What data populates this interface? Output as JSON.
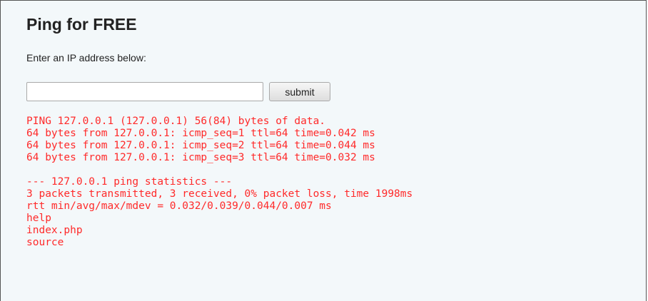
{
  "page": {
    "title": "Ping for FREE",
    "prompt": "Enter an IP address below:",
    "ip_input": {
      "value": "",
      "placeholder": ""
    },
    "submit_label": "submit"
  },
  "output": {
    "ping_lines": [
      "PING 127.0.0.1 (127.0.0.1) 56(84) bytes of data.",
      "64 bytes from 127.0.0.1: icmp_seq=1 ttl=64 time=0.042 ms",
      "64 bytes from 127.0.0.1: icmp_seq=2 ttl=64 time=0.044 ms",
      "64 bytes from 127.0.0.1: icmp_seq=3 ttl=64 time=0.032 ms"
    ],
    "stats_lines": [
      "--- 127.0.0.1 ping statistics ---",
      "3 packets transmitted, 3 received, 0% packet loss, time 1998ms",
      "rtt min/avg/max/mdev = 0.032/0.039/0.044/0.007 ms"
    ],
    "listing_lines": [
      "help",
      "index.php",
      "source"
    ]
  },
  "colors": {
    "output_text": "#ff2a2a",
    "panel_background": "#f3f8fa"
  }
}
